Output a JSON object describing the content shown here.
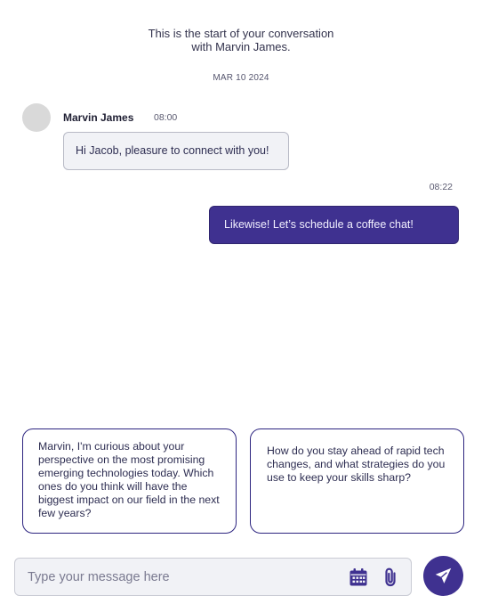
{
  "conversation": {
    "intro_line1": "This is the start of your conversation",
    "intro_line2": "with Marvin James.",
    "date": "MAR 10 2024"
  },
  "messages": [
    {
      "sender": "Marvin James",
      "time": "08:00",
      "text": "Hi Jacob, pleasure to connect with you!",
      "direction": "incoming"
    },
    {
      "time": "08:22",
      "text": "Likewise! Let’s schedule a coffee chat!",
      "direction": "outgoing"
    }
  ],
  "suggestions": [
    {
      "text": "Marvin, I'm curious about your perspective on the most promising emerging technologies today. Which ones do you think will have the biggest impact on our field in the next few years?"
    },
    {
      "text": "How do you stay ahead of rapid tech changes, and what strategies do you use to keep your skills sharp?"
    }
  ],
  "composer": {
    "placeholder": "Type your message here",
    "calendar_icon": "calendar-icon",
    "attach_icon": "paperclip-icon",
    "send_icon": "send-icon"
  },
  "colors": {
    "accent": "#3f3190",
    "incoming_bubble": "#f1f2f6",
    "avatar_placeholder": "#d9d9d9"
  }
}
